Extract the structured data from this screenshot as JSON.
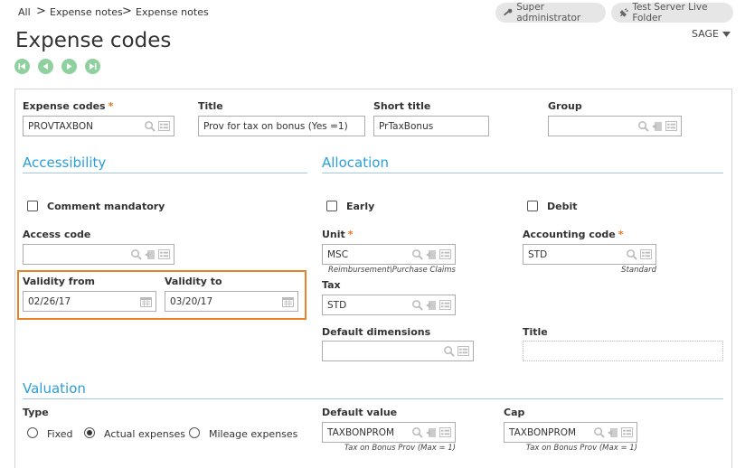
{
  "breadcrumb": [
    "All",
    "Expense notes",
    "Expense notes"
  ],
  "header": {
    "super_admin": "Super administrator",
    "server": "Test Server Live Folder",
    "title": "Expense codes",
    "sage": "SAGE"
  },
  "fields": {
    "expense_codes": {
      "label": "Expense codes",
      "value": "PROVTAXBON"
    },
    "title": {
      "label": "Title",
      "value": "Prov for tax on bonus (Yes =1)"
    },
    "short_title": {
      "label": "Short title",
      "value": "PrTaxBonus"
    },
    "group": {
      "label": "Group",
      "value": ""
    }
  },
  "accessibility": {
    "heading": "Accessibility",
    "comment_mandatory": "Comment mandatory",
    "access_code_label": "Access code",
    "access_code_value": "",
    "validity_from_label": "Validity from",
    "validity_from_value": "02/26/17",
    "validity_to_label": "Validity to",
    "validity_to_value": "03/20/17"
  },
  "allocation": {
    "heading": "Allocation",
    "early": "Early",
    "debit": "Debit",
    "unit_label": "Unit",
    "unit_value": "MSC",
    "unit_hint": "Reimbursement\\Purchase Claims",
    "accounting_label": "Accounting code",
    "accounting_value": "STD",
    "accounting_hint": "Standard",
    "tax_label": "Tax",
    "tax_value": "STD",
    "default_dimensions_label": "Default dimensions",
    "default_dimensions_value": "",
    "title_label": "Title",
    "title_value": ""
  },
  "valuation": {
    "heading": "Valuation",
    "type_label": "Type",
    "type_options": [
      "Fixed",
      "Actual expenses",
      "Mileage expenses"
    ],
    "selected": "Actual expenses",
    "default_value_label": "Default value",
    "default_value": "TAXBONPROM",
    "default_value_hint": "Tax on Bonus Prov (Max = 1)",
    "cap_label": "Cap",
    "cap_value": "TAXBONPROM",
    "cap_hint": "Tax on Bonus Prov (Max = 1)"
  },
  "colors": {
    "accent": "#2a9fd8",
    "required": "#e8731e",
    "highlight": "#e8822a",
    "nav": "#8fd19e"
  }
}
